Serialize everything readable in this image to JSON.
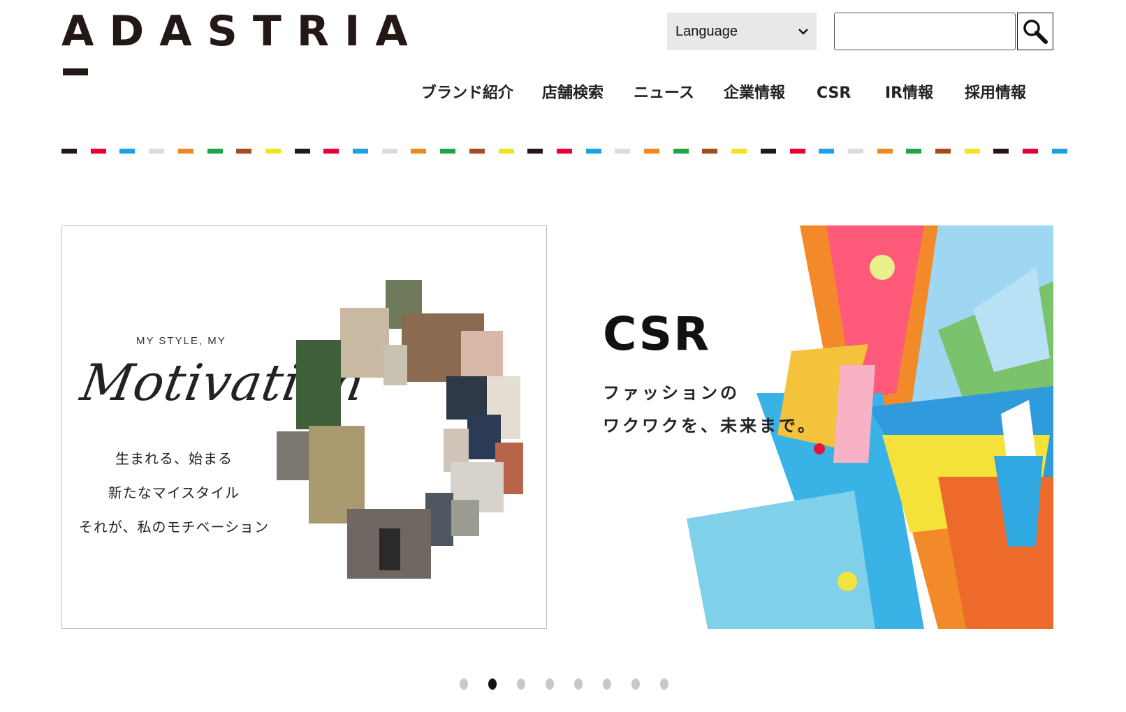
{
  "header": {
    "logo_text": "ADASTRIA",
    "language_select": {
      "selected": "Language",
      "options": [
        "Language"
      ]
    },
    "search": {
      "value": "",
      "placeholder": ""
    },
    "search_icon": "magnifier-icon"
  },
  "nav": {
    "items": [
      {
        "label": "ブランド紹介"
      },
      {
        "label": "店舗検索"
      },
      {
        "label": "ニュース"
      },
      {
        "label": "企業情報"
      },
      {
        "label": "CSR"
      },
      {
        "label": "IR情報"
      },
      {
        "label": "採用情報"
      }
    ]
  },
  "stripe_colors": [
    "#231815",
    "#e60033",
    "#1fa0e4",
    "#dcdcdc",
    "#ee8a1f",
    "#1ea548",
    "#a54c1f",
    "#f3e41d"
  ],
  "carousel": {
    "slide_left": {
      "eyebrow": "MY STYLE, MY",
      "script_title": "Motivation",
      "lines": [
        "生まれる、始まる",
        "新たなマイスタイル",
        "それが、私のモチベーション"
      ]
    },
    "slide_right": {
      "title": "CSR",
      "subtitle_lines": [
        "ファッションの",
        "ワクワクを、未来まで。"
      ]
    },
    "dot_count": 8,
    "active_index": 1
  }
}
